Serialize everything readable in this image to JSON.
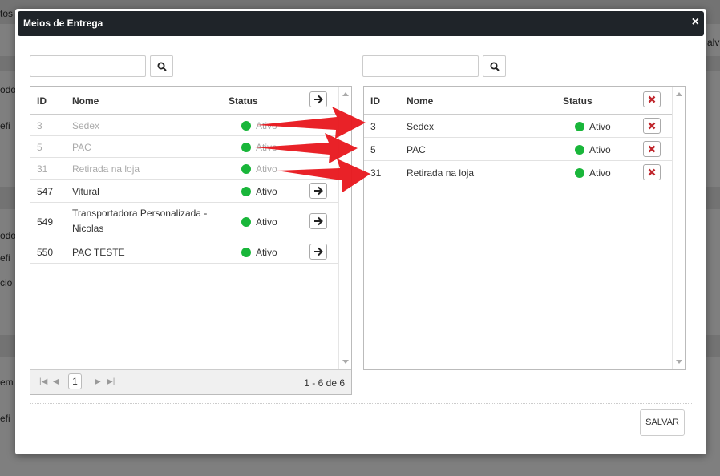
{
  "modal": {
    "title": "Meios de Entrega",
    "close_symbol": "×"
  },
  "left_panel": {
    "search": {
      "placeholder": "",
      "value": ""
    },
    "columns": {
      "id": "ID",
      "nome": "Nome",
      "status": "Status"
    },
    "rows": [
      {
        "id": "3",
        "nome": "Sedex",
        "status": "Ativo",
        "disabled": true
      },
      {
        "id": "5",
        "nome": "PAC",
        "status": "Ativo",
        "disabled": true
      },
      {
        "id": "31",
        "nome": "Retirada na loja",
        "status": "Ativo",
        "disabled": true
      },
      {
        "id": "547",
        "nome": "Vitural",
        "status": "Ativo",
        "disabled": false
      },
      {
        "id": "549",
        "nome_line1": "Transportadora Personalizada -",
        "nome_line2": "Nicolas",
        "status": "Ativo",
        "disabled": false
      },
      {
        "id": "550",
        "nome": "PAC TESTE",
        "status": "Ativo",
        "disabled": false
      }
    ],
    "pager": {
      "current_page": "1",
      "info": "1 - 6 de 6"
    }
  },
  "right_panel": {
    "search": {
      "placeholder": "",
      "value": ""
    },
    "columns": {
      "id": "ID",
      "nome": "Nome",
      "status": "Status"
    },
    "rows": [
      {
        "id": "3",
        "nome": "Sedex",
        "status": "Ativo"
      },
      {
        "id": "5",
        "nome": "PAC",
        "status": "Ativo"
      },
      {
        "id": "31",
        "nome": "Retirada na loja",
        "status": "Ativo"
      }
    ]
  },
  "footer": {
    "save_label": "SALVAR"
  },
  "background": {
    "fragments": [
      "tos",
      "odo",
      "efi",
      "odo",
      "efi",
      "cio",
      "em",
      "efi",
      "alv"
    ]
  },
  "colors": {
    "header_bg": "#1f2429",
    "status_active": "#19b63a",
    "remove_icon": "#c0262c",
    "annotation_arrow": "#e8161c"
  },
  "icons": {
    "search": "search-icon",
    "move_right": "arrow-right-icon",
    "remove": "remove-x-icon",
    "first_page": "first-page-icon",
    "prev_page": "prev-page-icon",
    "next_page": "next-page-icon",
    "last_page": "last-page-icon"
  }
}
